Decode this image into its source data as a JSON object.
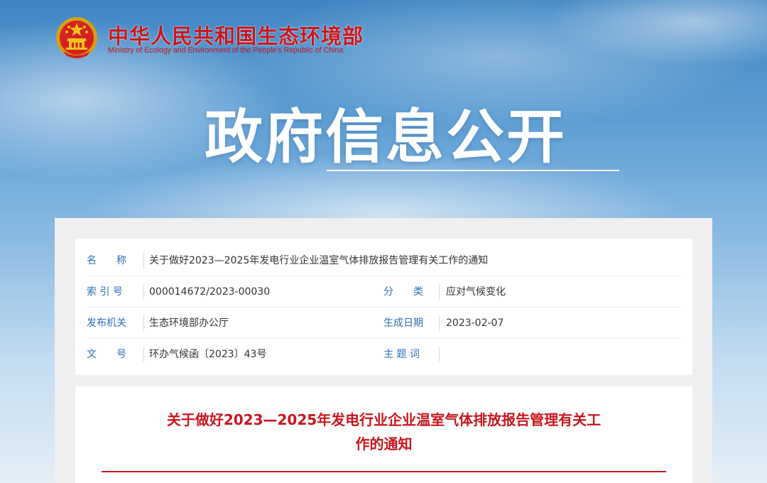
{
  "header": {
    "site_name": "中华人民共和国生态环境部",
    "site_name_en": "Ministry of Ecology and Environment of the People's Republic of China",
    "emblem_icon": "national-emblem-icon",
    "hero_title": "政府信息公开"
  },
  "colors": {
    "brand_red": "#c8161d",
    "label_blue": "#2a6fb8"
  },
  "meta": {
    "name_label": "名　　称",
    "name_value": "关于做好2023—2025年发电行业企业温室气体排放报告管理有关工作的通知",
    "index_label": "索 引 号",
    "index_value": "000014672/2023-00030",
    "category_label": "分　　类",
    "category_value": "应对气候变化",
    "issuer_label": "发布机关",
    "issuer_value": "生态环境部办公厅",
    "date_label": "生成日期",
    "date_value": "2023-02-07",
    "docno_label": "文　　号",
    "docno_value": "环办气候函〔2023〕43号",
    "subject_label": "主 题 词",
    "subject_value": ""
  },
  "document": {
    "title_line1": "关于做好2023—2025年发电行业企业温室气体排放报告管理有关工",
    "title_line2": "作的通知"
  }
}
